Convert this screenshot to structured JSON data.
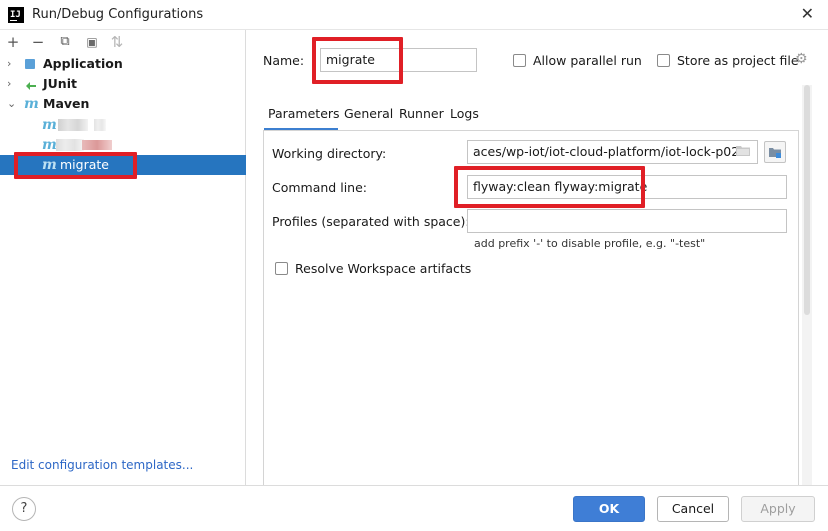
{
  "window": {
    "title": "Run/Debug Configurations",
    "app_icon_text": "IJ",
    "close_glyph": "✕"
  },
  "toolbar": {
    "add_glyph": "+",
    "remove_glyph": "−",
    "copy_glyph": "⧉",
    "folder_glyph": "▣",
    "sort_glyph": "⇅"
  },
  "tree": {
    "items": [
      {
        "label": "Application",
        "arrow": "›",
        "icon": "application-icon"
      },
      {
        "label": "JUnit",
        "arrow": "›",
        "icon": "junit-icon"
      },
      {
        "label": "Maven",
        "arrow": "⌄",
        "icon": "maven-icon"
      }
    ],
    "maven_glyph": "m",
    "selected_label": "migrate"
  },
  "edit_templates_label": "Edit configuration templates...",
  "form": {
    "name_label": "Name:",
    "name_value": "migrate",
    "allow_parallel_label": "Allow parallel run",
    "store_as_project_label": "Store as project file",
    "tabs": [
      "Parameters",
      "General",
      "Runner",
      "Logs"
    ],
    "working_directory_label": "Working directory:",
    "working_directory_value": "aces/wp-iot/iot-cloud-platform/iot-lock-p02",
    "command_line_label": "Command line:",
    "command_line_value": "flyway:clean flyway:migrate",
    "profiles_label": "Profiles (separated with space):",
    "profiles_value": "",
    "profiles_hint": "add prefix '-' to disable profile, e.g. \"-test\"",
    "resolve_workspace_label": "Resolve Workspace artifacts"
  },
  "buttons": {
    "help": "?",
    "ok": "OK",
    "cancel": "Cancel",
    "apply": "Apply"
  },
  "colors": {
    "accent": "#3f7ed6",
    "selection": "#2675bf",
    "highlight": "#e01f26",
    "link": "#2d67c6"
  }
}
